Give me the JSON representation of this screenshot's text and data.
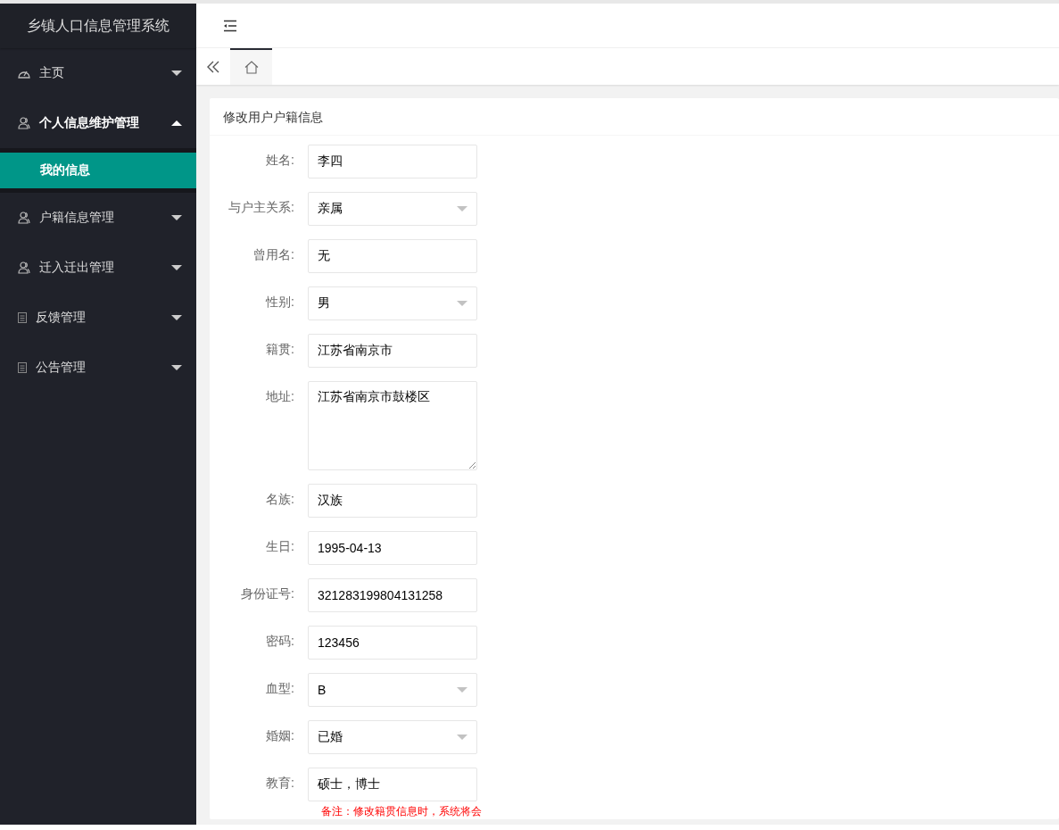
{
  "sidebar": {
    "title": "乡镇人口信息管理系统",
    "items": [
      {
        "label": "主页",
        "kind": "gauge",
        "expanded": false
      },
      {
        "label": "个人信息维护管理",
        "kind": "user",
        "expanded": true,
        "children": [
          {
            "label": "我的信息",
            "selected": true
          }
        ]
      },
      {
        "label": "户籍信息管理",
        "kind": "user",
        "expanded": false
      },
      {
        "label": "迁入迁出管理",
        "kind": "user",
        "expanded": false
      },
      {
        "label": "反馈管理",
        "kind": "doc",
        "expanded": false
      },
      {
        "label": "公告管理",
        "kind": "doc",
        "expanded": false
      }
    ]
  },
  "tabs": [
    {
      "kind": "home",
      "selected": true
    }
  ],
  "card": {
    "title": "修改用户户籍信息",
    "fields": [
      {
        "label": "姓名:",
        "kind": "input",
        "value": "李四"
      },
      {
        "label": "与户主关系:",
        "kind": "select",
        "value": "亲属"
      },
      {
        "label": "曾用名:",
        "kind": "input",
        "value": "无"
      },
      {
        "label": "性别:",
        "kind": "select",
        "value": "男"
      },
      {
        "label": "籍贯:",
        "kind": "input",
        "value": "江苏省南京市"
      },
      {
        "label": "地址:",
        "kind": "textarea",
        "value": "江苏省南京市鼓楼区"
      },
      {
        "label": "名族:",
        "kind": "input",
        "value": "汉族"
      },
      {
        "label": "生日:",
        "kind": "input",
        "value": "1995-04-13"
      },
      {
        "label": "身份证号:",
        "kind": "input",
        "value": "321283199804131258"
      },
      {
        "label": "密码:",
        "kind": "input",
        "value": "123456"
      },
      {
        "label": "血型:",
        "kind": "select",
        "value": "B"
      },
      {
        "label": "婚姻:",
        "kind": "select",
        "value": "已婚"
      },
      {
        "label": "教育:",
        "kind": "input",
        "value": "硕士，博士"
      }
    ],
    "note": "备注：修改籍贯信息时，系统将会"
  }
}
